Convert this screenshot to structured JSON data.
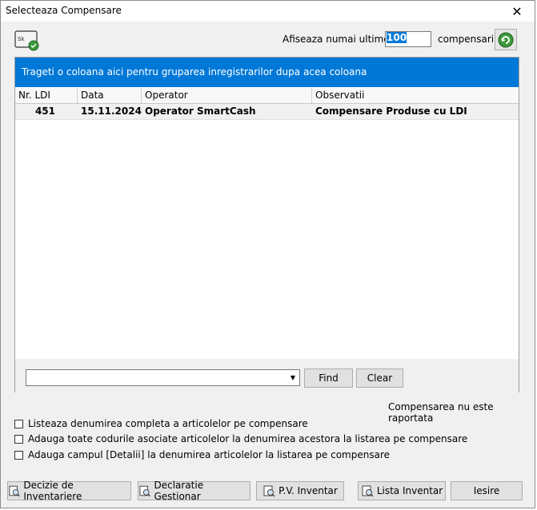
{
  "window": {
    "title": "Selecteaza Compensare",
    "close_glyph": "✕"
  },
  "toolbar": {
    "filter_prefix": "Afiseaza numai ultimele",
    "filter_count": "100",
    "filter_suffix": "compensari."
  },
  "grid": {
    "group_panel_text": "Trageti o coloana aici pentru gruparea inregistrarilor dupa acea coloana",
    "columns": [
      "Nr. LDI",
      "Data",
      "Operator",
      "Observatii"
    ],
    "rows": [
      {
        "nr_ldi": "451",
        "data": "15.11.2024",
        "operator": "Operator SmartCash",
        "observatii": "Compensare Produse cu LDI"
      }
    ]
  },
  "find": {
    "value": "",
    "find_label": "Find",
    "clear_label": "Clear"
  },
  "status_text": "Compensarea nu este raportata",
  "options": [
    {
      "label": "Listeaza denumirea completa a articolelor pe compensare",
      "checked": false
    },
    {
      "label": "Adauga toate codurile asociate articolelor la denumirea acestora la listarea pe compensare",
      "checked": false
    },
    {
      "label": "Adauga campul [Detalii] la denumirea articolelor la listarea pe compensare",
      "checked": false
    }
  ],
  "buttons": {
    "decizie": "Decizie de Inventariere",
    "declaratie": "Declaratie Gestionar",
    "pv": "P.V. Inventar",
    "lista": "Lista Inventar",
    "iesire": "Iesire"
  },
  "colors": {
    "accent": "#0078d7",
    "selected_row": "#f0f0f0"
  }
}
